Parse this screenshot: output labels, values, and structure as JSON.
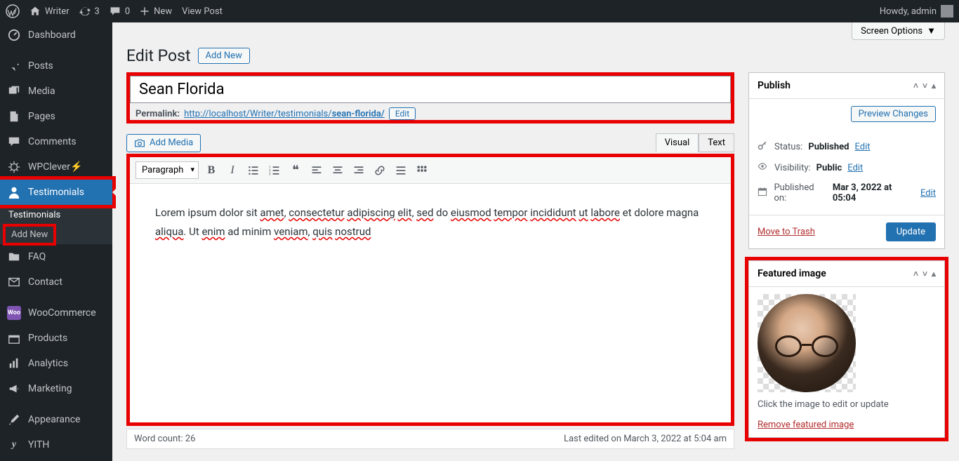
{
  "adminbar": {
    "site_name": "Writer",
    "updates_count": "3",
    "comments_count": "0",
    "new_label": "New",
    "view_post_label": "View Post",
    "howdy": "Howdy, admin"
  },
  "sidebar": {
    "items": [
      {
        "label": "Dashboard"
      },
      {
        "label": "Posts"
      },
      {
        "label": "Media"
      },
      {
        "label": "Pages"
      },
      {
        "label": "Comments"
      },
      {
        "label": "WPClever⚡"
      },
      {
        "label": "Testimonials"
      },
      {
        "label": "FAQ"
      },
      {
        "label": "Contact"
      },
      {
        "label": "WooCommerce"
      },
      {
        "label": "Products"
      },
      {
        "label": "Analytics"
      },
      {
        "label": "Marketing"
      },
      {
        "label": "Appearance"
      },
      {
        "label": "YITH"
      }
    ],
    "submenu": {
      "top": "Testimonials",
      "add_new": "Add New"
    }
  },
  "screen_options_label": "Screen Options",
  "page": {
    "heading": "Edit Post",
    "add_new": "Add New",
    "title_value": "Sean Florida",
    "permalink_label": "Permalink:",
    "permalink_base": "http://localhost/Writer/testimonials/",
    "permalink_slug": "sean-florida/",
    "edit_label": "Edit",
    "add_media": "Add Media",
    "tab_visual": "Visual",
    "tab_text": "Text",
    "format_select": "Paragraph",
    "body_plain": "Lorem ipsum dolor sit amet, consectetur adipiscing elit, sed do eiusmod tempor incididunt ut labore et dolore magna aliqua. Ut enim ad minim veniam, quis nostrud",
    "word_count_label": "Word count: 26",
    "last_edited": "Last edited on March 3, 2022 at 5:04 am"
  },
  "publish": {
    "title": "Publish",
    "preview": "Preview Changes",
    "status_label": "Status:",
    "status_value": "Published",
    "visibility_label": "Visibility:",
    "visibility_value": "Public",
    "published_label": "Published on:",
    "published_value": "Mar 3, 2022 at 05:04",
    "edit": "Edit",
    "trash": "Move to Trash",
    "update": "Update"
  },
  "featured": {
    "title": "Featured image",
    "hint": "Click the image to edit or update",
    "remove": "Remove featured image"
  }
}
